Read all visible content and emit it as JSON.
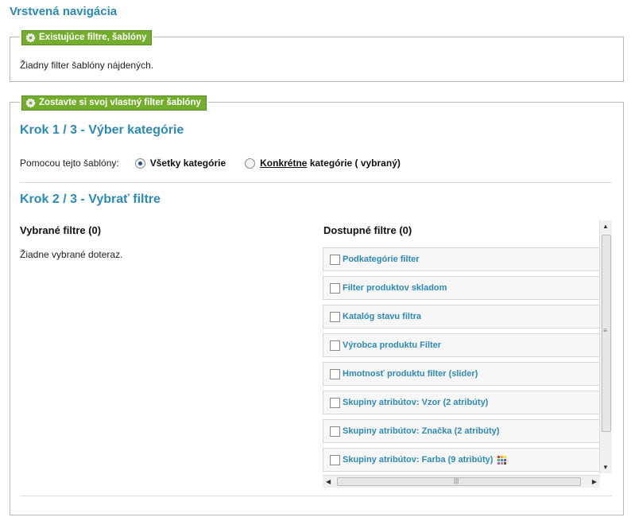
{
  "page": {
    "title": "Vrstvená navigácia"
  },
  "existing": {
    "legend": "Existujúce filtre, šablóny",
    "message": "Žiadny filter šablóny nájdených."
  },
  "custom": {
    "legend": "Zostavte si svoj vlastný filter šablóny",
    "step1": {
      "title": "Krok 1 / 3 - Výber kategórie",
      "label": "Pomocou tejto šablóny:",
      "option_all": "Všetky kategórie",
      "option_specific_link": "Konkrétne",
      "option_specific_rest": " kategórie ( vybraný)",
      "selected": "all"
    },
    "step2": {
      "title": "Krok 2 / 3 - Vybrať filtre",
      "selected_title": "Vybrané filtre (0)",
      "selected_empty": "Žiadne vybrané doteraz.",
      "available_title": "Dostupné filtre (0)",
      "filters": [
        {
          "label": "Podkategórie filter",
          "checked": false
        },
        {
          "label": "Filter produktov skladom",
          "checked": false
        },
        {
          "label": "Katalóg stavu filtra",
          "checked": false
        },
        {
          "label": "Výrobca produktu Filter",
          "checked": false
        },
        {
          "label": "Hmotnosť produktu filter (slider)",
          "checked": false
        },
        {
          "label": "Skupiny atribútov: Vzor (2 atribúty)",
          "checked": false
        },
        {
          "label": "Skupiny atribútov: Značka (2 atribúty)",
          "checked": false
        },
        {
          "label": "Skupiny atribútov: Farba (9 atribúty)",
          "checked": false,
          "icon": "color-grid-icon"
        }
      ]
    }
  },
  "colors": {
    "accent": "#2b8ab8",
    "legend_bg": "#73ad2c"
  }
}
